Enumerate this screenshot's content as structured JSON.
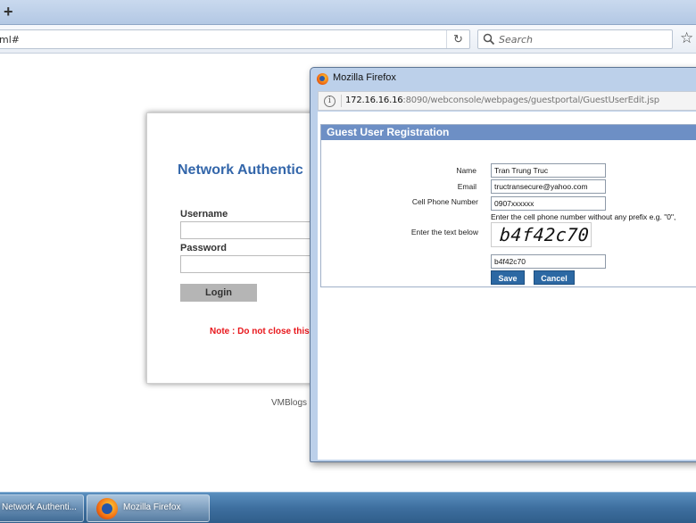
{
  "browser": {
    "new_tab_symbol": "+",
    "url_fragment": "ml#",
    "reload_icon": "reload-icon",
    "search_placeholder": "Search",
    "bookmark_icon": "star-icon"
  },
  "login_page": {
    "title": "Network Authentic",
    "username_label": "Username",
    "password_label": "Password",
    "login_button": "Login",
    "note": "Note : Do not close this",
    "footer": "VMBlogs"
  },
  "popup": {
    "window_title": "Mozilla Firefox",
    "url_host": "172.16.16.16",
    "url_path": ":8090/webconsole/webpages/guestportal/GuestUserEdit.jsp",
    "form_title": "Guest User Registration",
    "fields": {
      "name_label": "Name",
      "name_value": "Tran Trung Truc",
      "email_label": "Email",
      "email_value": "tructransecure@yahoo.com",
      "phone_label": "Cell Phone Number",
      "phone_value": "0907xxxxxx",
      "phone_hint": "Enter the cell phone number without any prefix e.g. \"0\",",
      "captcha_label": "Enter the text below",
      "captcha_image_text": "b4f42c70",
      "captcha_value": "b4f42c70"
    },
    "save_button": "Save",
    "cancel_button": "Cancel"
  },
  "taskbar": {
    "items": [
      {
        "label": "Network Authenti..."
      },
      {
        "label": "Mozilla Firefox"
      }
    ]
  },
  "colors": {
    "accent_blue": "#3366aa",
    "note_red": "#e8161b",
    "form_header": "#6d8fc5",
    "button_blue": "#2c68a3"
  }
}
